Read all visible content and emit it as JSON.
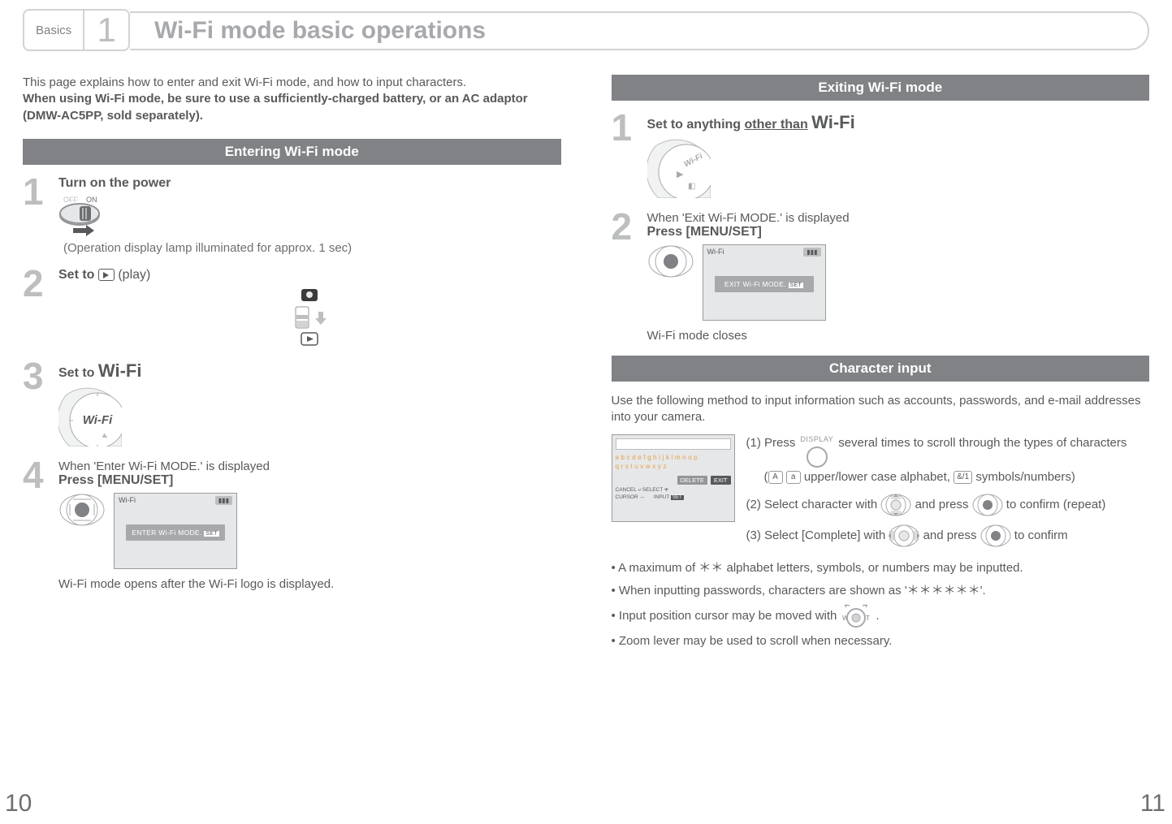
{
  "header": {
    "tab_label": "Basics",
    "tab_number": "1",
    "title": "Wi-Fi mode basic operations"
  },
  "intro": {
    "line1": "This page explains how to enter and exit Wi-Fi mode, and how to input characters.",
    "line2": "When using Wi-Fi mode, be sure to use a sufficiently-charged battery, or an AC adaptor (DMW-AC5PP, sold separately)."
  },
  "entering": {
    "heading": "Entering Wi-Fi mode",
    "steps": {
      "s1": {
        "num": "1",
        "title": "Turn on the power",
        "note": "(Operation display lamp illuminated for approx. 1 sec)",
        "off": "OFF",
        "on": "ON"
      },
      "s2": {
        "num": "2",
        "title_prefix": "Set to ",
        "title_suffix": " (play)"
      },
      "s3": {
        "num": "3",
        "title_prefix": "Set to ",
        "wifi": "Wi-Fi"
      },
      "s4": {
        "num": "4",
        "pre": "When 'Enter Wi-Fi MODE.' is displayed",
        "title": "Press [MENU/SET]",
        "screen_top": "Wi-Fi",
        "screen_msg": "ENTER Wi-Fi MODE.",
        "after": "Wi-Fi mode opens after the Wi-Fi logo is displayed."
      }
    }
  },
  "exiting": {
    "heading": "Exiting Wi-Fi mode",
    "steps": {
      "s1": {
        "num": "1",
        "title_prefix": "Set to anything ",
        "title_mid": "other than",
        "wifi": "Wi-Fi"
      },
      "s2": {
        "num": "2",
        "pre": "When 'Exit Wi-Fi MODE.' is displayed",
        "title": "Press [MENU/SET]",
        "screen_top": "Wi-Fi",
        "screen_msg": "EXIT Wi-Fi MODE.",
        "after": "Wi-Fi mode closes"
      }
    }
  },
  "charinput": {
    "heading": "Character input",
    "intro": "Use the following method to input information such as accounts, passwords, and e-mail addresses into your camera.",
    "display_label": "DISPLAY",
    "screen": {
      "row1": "abcdefghijklmnop",
      "row2": "qrstuvwxyz",
      "delete": "DELETE",
      "exit": "EXIT",
      "cancel": "CANCEL",
      "select": "SELECT",
      "cursor": "CURSOR",
      "input": "INPUT"
    },
    "instr": {
      "i1a": "(1) Press",
      "i1b": "several times to scroll through the types of characters",
      "i1c_open": "(",
      "i1c_upper": "A",
      "i1c_lower": "a",
      "i1c_mid": " upper/lower case alphabet, ",
      "i1c_sym": "&/1",
      "i1c_end": " symbols/numbers)",
      "i2a": "(2) Select character with",
      "i2b": "and press",
      "i2c": "to confirm (repeat)",
      "i3a": "(3) Select [Complete] with",
      "i3b": "and press",
      "i3c": "to confirm"
    },
    "bullets": {
      "b1a": "• A maximum of ",
      "b1b": " alphabet letters, symbols, or numbers may be inputted.",
      "b2a": "• When inputting passwords, characters are shown as '",
      "b2b": "'.",
      "b3a": "• Input position cursor may be moved with ",
      "b3b": ".",
      "b4": "• Zoom lever may be used to scroll when necessary.",
      "stars2": "＊＊",
      "stars6": "＊＊＊＊＊＊"
    }
  },
  "pages": {
    "left": "10",
    "right": "11"
  }
}
